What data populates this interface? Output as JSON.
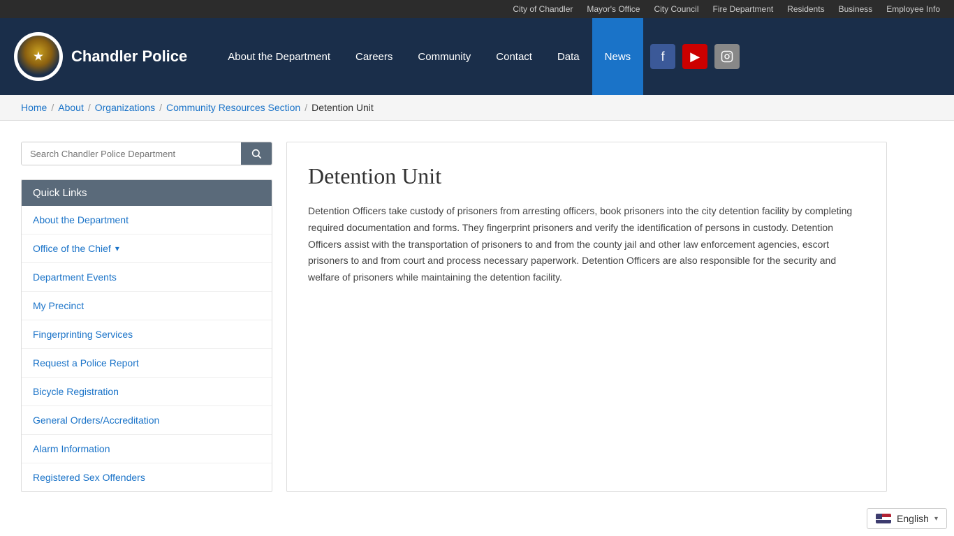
{
  "topbar": {
    "links": [
      {
        "label": "City of Chandler",
        "id": "city-of-chandler"
      },
      {
        "label": "Mayor's Office",
        "id": "mayors-office"
      },
      {
        "label": "City Council",
        "id": "city-council"
      },
      {
        "label": "Fire Department",
        "id": "fire-department"
      },
      {
        "label": "Residents",
        "id": "residents"
      },
      {
        "label": "Business",
        "id": "business"
      },
      {
        "label": "Employee Info",
        "id": "employee-info"
      }
    ]
  },
  "header": {
    "site_title": "Chandler Police",
    "nav": [
      {
        "label": "About the Department",
        "id": "about-dept",
        "active": false
      },
      {
        "label": "Careers",
        "id": "careers",
        "active": false
      },
      {
        "label": "Community",
        "id": "community",
        "active": false
      },
      {
        "label": "Contact",
        "id": "contact",
        "active": false
      },
      {
        "label": "Data",
        "id": "data",
        "active": false
      },
      {
        "label": "News",
        "id": "news",
        "active": true
      }
    ],
    "social": [
      {
        "platform": "facebook",
        "label": "f"
      },
      {
        "platform": "youtube",
        "label": "▶"
      },
      {
        "platform": "instagram",
        "label": "📷"
      }
    ]
  },
  "breadcrumb": {
    "items": [
      {
        "label": "Home",
        "link": true
      },
      {
        "label": "About",
        "link": true
      },
      {
        "label": "Organizations",
        "link": true
      },
      {
        "label": "Community Resources Section",
        "link": true
      },
      {
        "label": "Detention Unit",
        "link": false
      }
    ]
  },
  "sidebar": {
    "search_placeholder": "Search Chandler Police Department",
    "search_btn_icon": "🔍",
    "quick_links_header": "Quick Links",
    "links": [
      {
        "label": "About the Department",
        "has_arrow": false
      },
      {
        "label": "Office of the Chief",
        "has_arrow": true
      },
      {
        "label": "Department Events",
        "has_arrow": false
      },
      {
        "label": "My Precinct",
        "has_arrow": false
      },
      {
        "label": "Fingerprinting Services",
        "has_arrow": false
      },
      {
        "label": "Request a Police Report",
        "has_arrow": false
      },
      {
        "label": "Bicycle Registration",
        "has_arrow": false
      },
      {
        "label": "General Orders/Accreditation",
        "has_arrow": false
      },
      {
        "label": "Alarm Information",
        "has_arrow": false
      },
      {
        "label": "Registered Sex Offenders",
        "has_arrow": false
      }
    ]
  },
  "content": {
    "title": "Detention Unit",
    "body": "Detention Officers take custody of prisoners from arresting officers, book prisoners into the city detention facility by completing required documentation and forms. They fingerprint prisoners and verify the identification of persons in custody. Detention Officers assist with the transportation of prisoners to and from the county jail and other law enforcement agencies, escort prisoners to and from court and process necessary paperwork. Detention Officers are also responsible for the security and welfare of prisoners while maintaining the detention facility."
  },
  "language": {
    "flag_alt": "English flag",
    "label": "English"
  }
}
